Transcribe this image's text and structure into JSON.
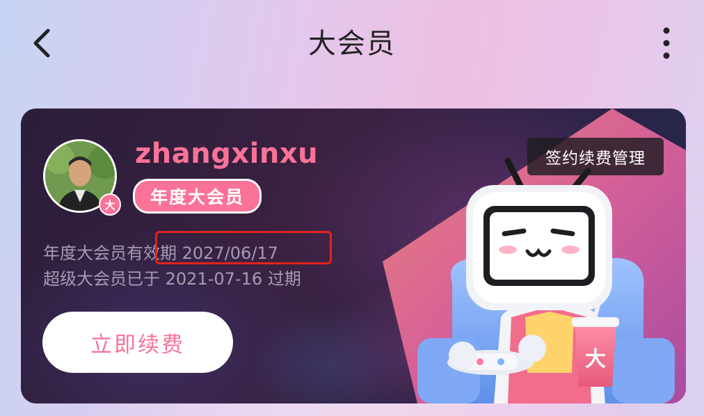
{
  "header": {
    "title": "大会员",
    "back_icon": "chevron-left-icon",
    "more_icon": "more-vertical-icon"
  },
  "card": {
    "username": "zhangxinxu",
    "vip_tag": "年度大会员",
    "avatar_badge": "大",
    "info_line1_prefix": "年度大会员有",
    "info_line1_highlight": "效期 2027/06/17",
    "info_line2": "超级大会员已于 2021-07-16 过期",
    "renew_button": "立即续费",
    "manage_button": "签约续费管理",
    "cup_label": "大"
  },
  "colors": {
    "accent_pink": "#fb7299",
    "highlight_red": "#e2231a",
    "card_dark": "#2a1d3b"
  }
}
